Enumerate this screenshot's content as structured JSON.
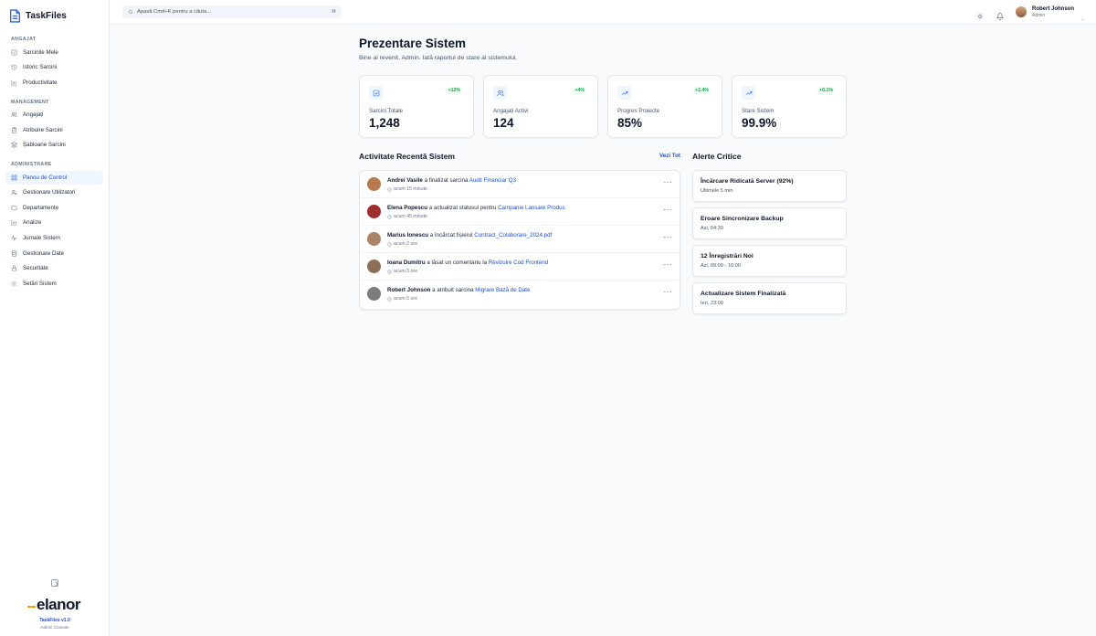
{
  "app": {
    "name": "TaskFiles",
    "version": "TaskFiles v1.0",
    "console": "Admin Console",
    "brand": "elanor"
  },
  "sidebar": {
    "sections": [
      {
        "label": "ANGAJAT",
        "items": [
          {
            "label": "Sarcinile Mele",
            "icon": "check-square-icon"
          },
          {
            "label": "Istoric Sarcini",
            "icon": "history-icon"
          },
          {
            "label": "Productivitate",
            "icon": "bar-chart-icon"
          }
        ]
      },
      {
        "label": "MANAGEMENT",
        "items": [
          {
            "label": "Angajați",
            "icon": "users-icon"
          },
          {
            "label": "Atribuire Sarcini",
            "icon": "clipboard-icon"
          },
          {
            "label": "Șabloane Sarcini",
            "icon": "layers-icon"
          }
        ]
      },
      {
        "label": "ADMINISTRARE",
        "items": [
          {
            "label": "Panou de Control",
            "icon": "grid-icon",
            "active": true
          },
          {
            "label": "Gestionare Utilizatori",
            "icon": "user-cog-icon"
          },
          {
            "label": "Departamente",
            "icon": "folder-icon"
          },
          {
            "label": "Analize",
            "icon": "bar-chart-icon"
          },
          {
            "label": "Jurnale Sistem",
            "icon": "activity-icon"
          },
          {
            "label": "Gestionare Date",
            "icon": "database-icon"
          },
          {
            "label": "Securitate",
            "icon": "lock-icon"
          },
          {
            "label": "Setări Sistem",
            "icon": "gear-icon"
          }
        ]
      }
    ]
  },
  "topbar": {
    "search_placeholder": "Apasă Cmd+K pentru a căuta...",
    "search_shortcut": "⌘",
    "user": {
      "name": "Robert Johnson",
      "role": "Admin"
    }
  },
  "main": {
    "title": "Prezentare Sistem",
    "subtitle": "Bine ai revenit, Admin. Iată raportul de stare al sistemului.",
    "stats": [
      {
        "label": "Sarcini Totale",
        "value": "1,248",
        "delta": "+12%",
        "icon": "check-square-icon"
      },
      {
        "label": "Angajați Activi",
        "value": "124",
        "delta": "+4%",
        "icon": "users-icon"
      },
      {
        "label": "Progres Proiecte",
        "value": "85%",
        "delta": "+2.4%",
        "icon": "trending-up-icon"
      },
      {
        "label": "Stare Sistem",
        "value": "99.9%",
        "delta": "+0.1%",
        "icon": "trending-up-icon"
      }
    ],
    "activity": {
      "title": "Activitate Recentă Sistem",
      "view_all": "Vezi Tot",
      "items": [
        {
          "who": "Andrei Vasile",
          "action": " a finalizat sarcina ",
          "target": "Audit Financiar Q3",
          "time": "acum 15 minute",
          "avatar_color": "#b7794f"
        },
        {
          "who": "Elena Popescu",
          "action": " a actualizat statusul pentru ",
          "target": "Campanie Lansare Produs",
          "time": "acum 45 minute",
          "avatar_color": "#9f2d2d"
        },
        {
          "who": "Marius Ionescu",
          "action": " a încărcat fișierul ",
          "target": "Contract_Colaborare_2024.pdf",
          "time": "acum 2 ore",
          "avatar_color": "#a98468"
        },
        {
          "who": "Ioana Dumitru",
          "action": " a lăsat un comentariu la ",
          "target": "Revizuire Cod Frontend",
          "time": "acum 3 ore",
          "avatar_color": "#8d6e57"
        },
        {
          "who": "Robert Johnson",
          "action": " a atribuit sarcina ",
          "target": "Migrare Bază de Date",
          "time": "acum 5 ore",
          "avatar_color": "#7c7c7c"
        }
      ]
    },
    "alerts": {
      "title": "Alerte Critice",
      "items": [
        {
          "title": "Încărcare Ridicată Server (92%)",
          "sub": "Ultimele 5 min"
        },
        {
          "title": "Eroare Sincronizare Backup",
          "sub": "Azi, 04:30"
        },
        {
          "title": "12 Înregistrări Noi",
          "sub": "Azi, 09:00 - 10:00"
        },
        {
          "title": "Actualizare Sistem Finalizată",
          "sub": "Ieri, 23:00"
        }
      ]
    }
  },
  "colors": {
    "accent": "#2563eb",
    "positive": "#16a34a",
    "brand_mark": "#f59e0b"
  }
}
